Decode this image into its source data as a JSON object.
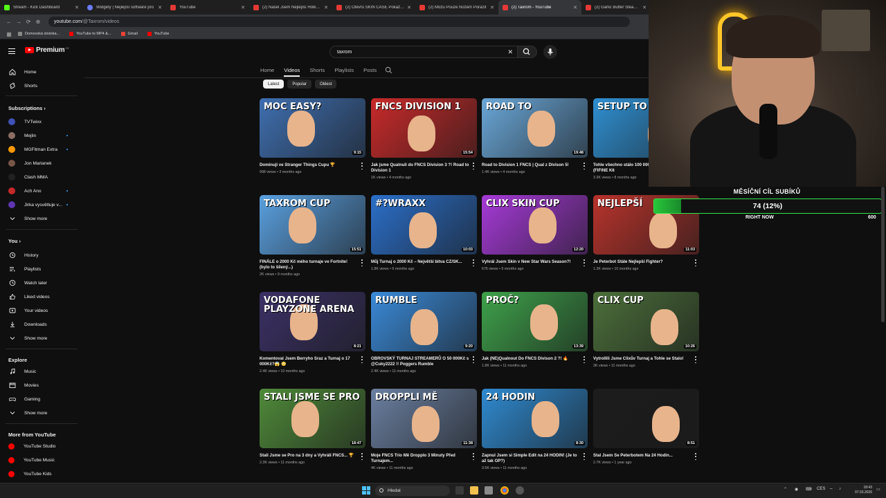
{
  "browser": {
    "tabs": [
      {
        "label": "Stream - Kick Dashboard",
        "icon": "kick-icon"
      },
      {
        "label": "Widgety | Nejlepší software pro",
        "icon": "widget-icon"
      },
      {
        "label": "YouTube",
        "icon": "youtube-icon"
      },
      {
        "label": "(2) Našel Jsem Nejlepší Holku v",
        "icon": "youtube-icon"
      },
      {
        "label": "(2) Otevřu SKIN CASE Pokaždé",
        "icon": "youtube-icon"
      },
      {
        "label": "(2) Můžu Pouze Nožem Porazit",
        "icon": "youtube-icon"
      },
      {
        "label": "(2) Taxrom - YouTube",
        "icon": "youtube-icon",
        "active": true
      },
      {
        "label": "(2) Garlic Butter Steaks an",
        "icon": "youtube-icon"
      }
    ],
    "url_host": "youtube.com",
    "url_path": "/@Taxrom/videos",
    "bookmarks": [
      "Domovská stránka...",
      "YouTube to MP4 &...",
      "Gmail",
      "YouTube"
    ]
  },
  "header": {
    "logo_text": "Premium",
    "logo_region": "CZ",
    "search_value": "taxrom"
  },
  "sidebar": {
    "home": "Home",
    "shorts": "Shorts",
    "subscriptions_heading": "Subscriptions",
    "subscriptions": [
      {
        "label": "TVTwixx",
        "color": "#3f51b5"
      },
      {
        "label": "Mejlin",
        "color": "#8d6e63"
      },
      {
        "label": "MGFitman Extra",
        "color": "#ff9800"
      },
      {
        "label": "Jon Marianek",
        "color": "#795548"
      },
      {
        "label": "Clash MMA",
        "color": "#212121"
      },
      {
        "label": "Ach Ano",
        "color": "#c62828"
      },
      {
        "label": "Jirka vysvětluje v...",
        "color": "#5e35b1"
      }
    ],
    "show_more": "Show more",
    "you_heading": "You",
    "you_items": [
      "History",
      "Playlists",
      "Watch later",
      "Liked videos",
      "Your videos",
      "Downloads"
    ],
    "explore_heading": "Explore",
    "explore_items": [
      "Music",
      "Movies",
      "Gaming"
    ],
    "more_heading": "More from YouTube",
    "more_items": [
      "YouTube Studio",
      "YouTube Music",
      "YouTube Kids"
    ]
  },
  "channel": {
    "tabs": [
      "Home",
      "Videos",
      "Shorts",
      "Playlists",
      "Posts"
    ],
    "active_tab": "Videos",
    "chips": [
      "Latest",
      "Popular",
      "Oldest"
    ],
    "active_chip": "Latest"
  },
  "videos": [
    {
      "title": "Dominuji ve Stranger Things Cupu 🏆",
      "meta": "998 views • 3 months ago",
      "duration": "9:15",
      "thumb_text": "MOC EASY?",
      "bg": "#3f6fb0"
    },
    {
      "title": "Jak jsme Qualnuli do FNCS Division 3 ?! Road to Division 1",
      "meta": "1K views • 4 months ago",
      "duration": "15:54",
      "thumb_text": "FNCS DIVISION 1",
      "bg": "#c92a2a"
    },
    {
      "title": "Road to Division 1 FNCS | Qual z Divison 5!",
      "meta": "1.4K views • 4 months ago",
      "duration": "19:48",
      "thumb_text": "ROAD TO",
      "bg": "#6aa7d8"
    },
    {
      "title": "Tohle všechno stálo 100 000 Kč? Tour + Q&A 🔊 (FIFINE K6",
      "meta": "3.3K views • 8 months ago",
      "duration": "",
      "thumb_text": "SETUP TO",
      "bg": "#2f8fd1"
    },
    {
      "title": "FINÁLE o 2000 Kč mého turnaje ve Fortnite! (bylo to šílený...)",
      "meta": "2K views • 9 months ago",
      "duration": "15:51",
      "thumb_text": "TAXROM CUP",
      "bg": "#5aa0e0"
    },
    {
      "title": "Můj Turnaj o 2000 Kč – Největší bitva CZ/SK...",
      "meta": "1.8K views • 9 months ago",
      "duration": "10:03",
      "thumb_text": "#?WRAXX",
      "bg": "#2b6fc9"
    },
    {
      "title": "Vyhrál Jsem Skin v New Star Wars Season?!",
      "meta": "676 views • 9 months ago",
      "duration": "12:20",
      "thumb_text": "CLIX SKIN CUP",
      "bg": "#a63ad8"
    },
    {
      "title": "Je Peterbot Stále Nejlepší Fighter?",
      "meta": "1.3K views • 10 months ago",
      "duration": "11:03",
      "thumb_text": "NEJLEPŠÍ",
      "bg": "#b8332c"
    },
    {
      "title": "Komentoval Jsem Berryho Sraz a Turnaj o 17 000Kč?😱 😳",
      "meta": "2.4K views • 10 months ago",
      "duration": "8:21",
      "thumb_text": "VODAFONE PLAYZONE ARENA",
      "bg": "#3b3166"
    },
    {
      "title": "OBROVSKÝ TURNAJ STREAMERŮ O 50 000Kč s @Cuky2222 !! Poggers Rumble",
      "meta": "2.4K views • 11 months ago",
      "duration": "9:20",
      "thumb_text": "RUMBLE",
      "bg": "#3a8ad8"
    },
    {
      "title": "Jak (NE)Qualnout Do FNCS Divison 2 ?! 🔥",
      "meta": "1.8K views • 11 months ago",
      "duration": "13:39",
      "thumb_text": "PROČ?",
      "bg": "#3ea14a"
    },
    {
      "title": "Vytrollili Jsme Clixův Turnaj a Tohle se Stalo!",
      "meta": "3K views • 11 months ago",
      "duration": "10:26",
      "thumb_text": "CLIX CUP",
      "bg": "#4b6f3a"
    },
    {
      "title": "Stali Jsme se Pro na 3 dny a Vyhráli FNCS... 🏆",
      "meta": "2.3K views • 11 months ago",
      "duration": "18:47",
      "thumb_text": "STALI JSME SE PRO",
      "bg": "#4f8a3a"
    },
    {
      "title": "Moje FNCS Trio Mě Dropplo 3 Minuty Před Turnajem...",
      "meta": "4K views • 11 months ago",
      "duration": "11:38",
      "thumb_text": "DROPPLI MĚ",
      "bg": "#6a7fa0"
    },
    {
      "title": "Zapnul Jsem si Simple Edit na 24 HODIN! (Je to až tak OP?)",
      "meta": "3.5K views • 11 months ago",
      "duration": "8:30",
      "thumb_text": "24 HODIN",
      "bg": "#2f8ad0"
    },
    {
      "title": "Stal Jsem Se Peterbotem Na 24 Hodin...",
      "meta": "2.7K views • 1 year ago",
      "duration": "8:51",
      "thumb_text": "",
      "bg": "#1c1c1c"
    }
  ],
  "overlay": {
    "goal_title": "MĚSÍČNÍ CÍL SUBÍKŮ",
    "goal_value": "74 (12%)",
    "goal_fraction": 0.12,
    "left_label": "RIGHT NOW",
    "right_label": "600"
  },
  "taskbar": {
    "search_label": "Hledat",
    "lang": "CES",
    "time": "18:43",
    "date": "07.03.2026"
  }
}
